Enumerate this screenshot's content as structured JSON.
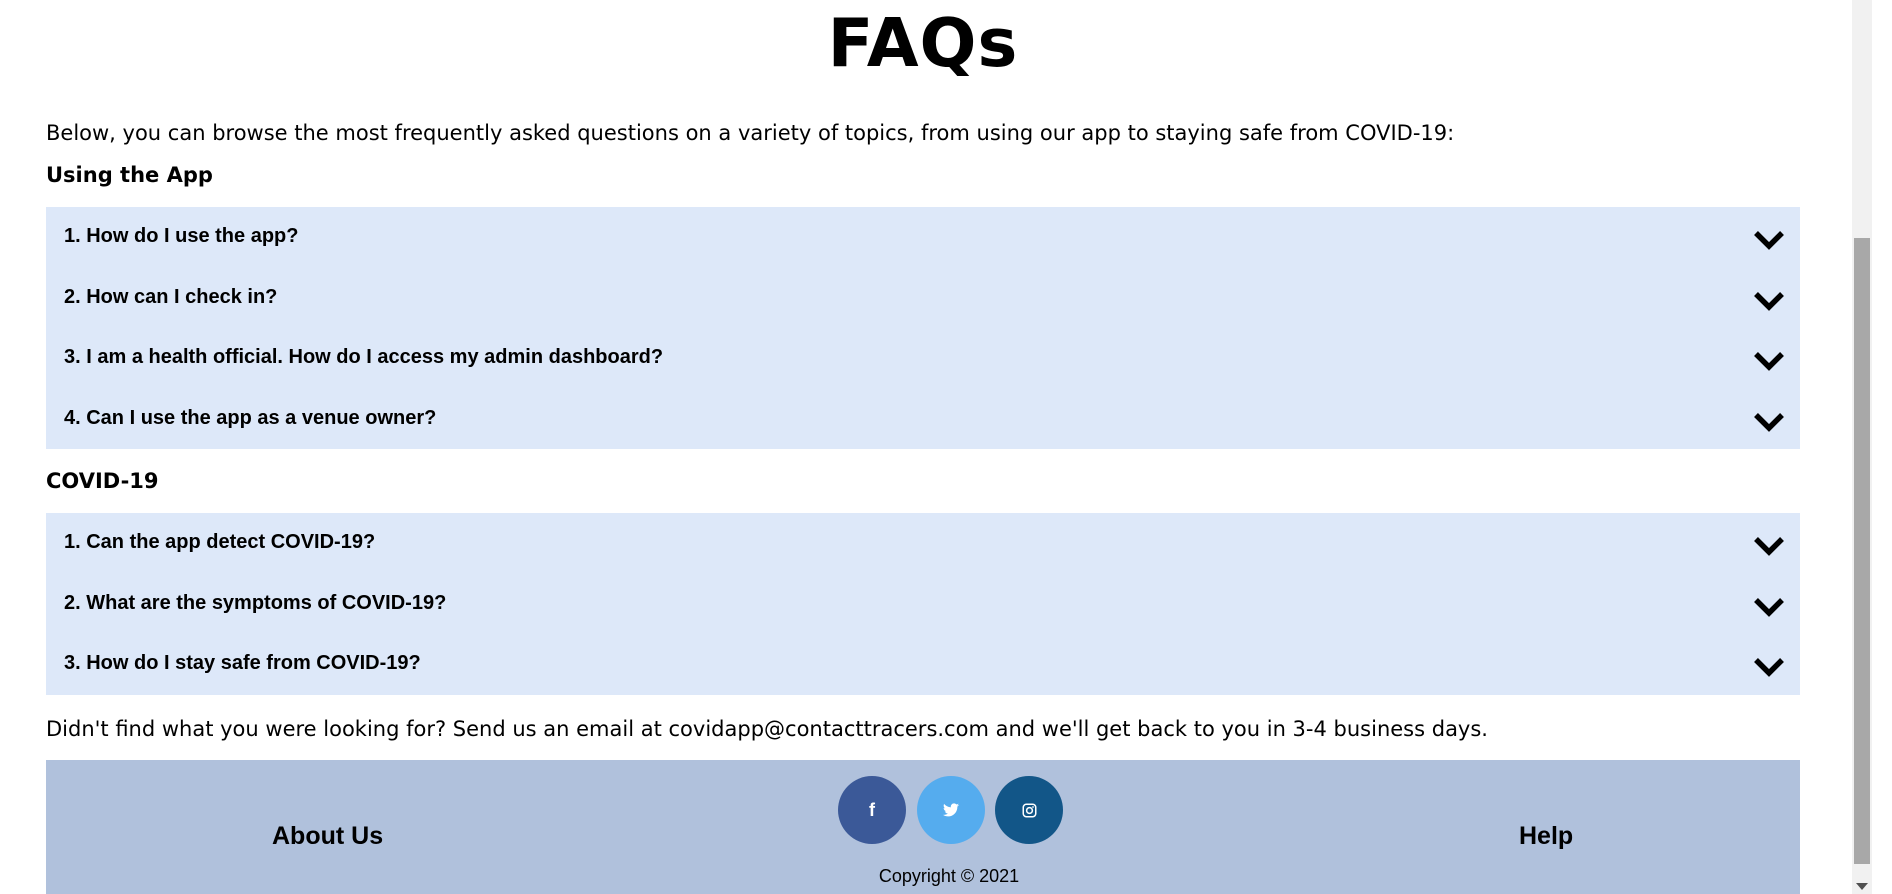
{
  "page": {
    "title": "FAQs",
    "intro": "Below, you can browse the most frequently asked questions on a variety of topics, from using our app to staying safe from COVID-19:"
  },
  "sections": [
    {
      "heading": "Using the App",
      "questions": [
        "1. How do I use the app?",
        "2. How can I check in?",
        "3. I am a health official. How do I access my admin dashboard?",
        "4. Can I use the app as a venue owner?"
      ]
    },
    {
      "heading": "COVID-19",
      "questions": [
        "1. Can the app detect COVID-19?",
        "2. What are the symptoms of COVID-19?",
        "3. How do I stay safe from COVID-19?"
      ]
    }
  ],
  "footer_note": "Didn't find what you were looking for? Send us an email at covidapp@contacttracers.com and we'll get back to you in 3-4 business days.",
  "footer": {
    "about_label": "About Us",
    "help_label": "Help",
    "copyright": "Copyright © 2021",
    "social": [
      {
        "name": "facebook-icon",
        "glyph": "f",
        "color": "#3b5998"
      },
      {
        "name": "twitter-icon",
        "glyph": "twitter-bird",
        "color": "#55acee"
      },
      {
        "name": "instagram-icon",
        "glyph": "instagram-camera",
        "color": "#125688"
      }
    ]
  },
  "colors": {
    "faq_background": "#dde8f9",
    "footer_background": "#b0c1dc"
  },
  "icons": {
    "expand": "chevron-down-icon"
  }
}
